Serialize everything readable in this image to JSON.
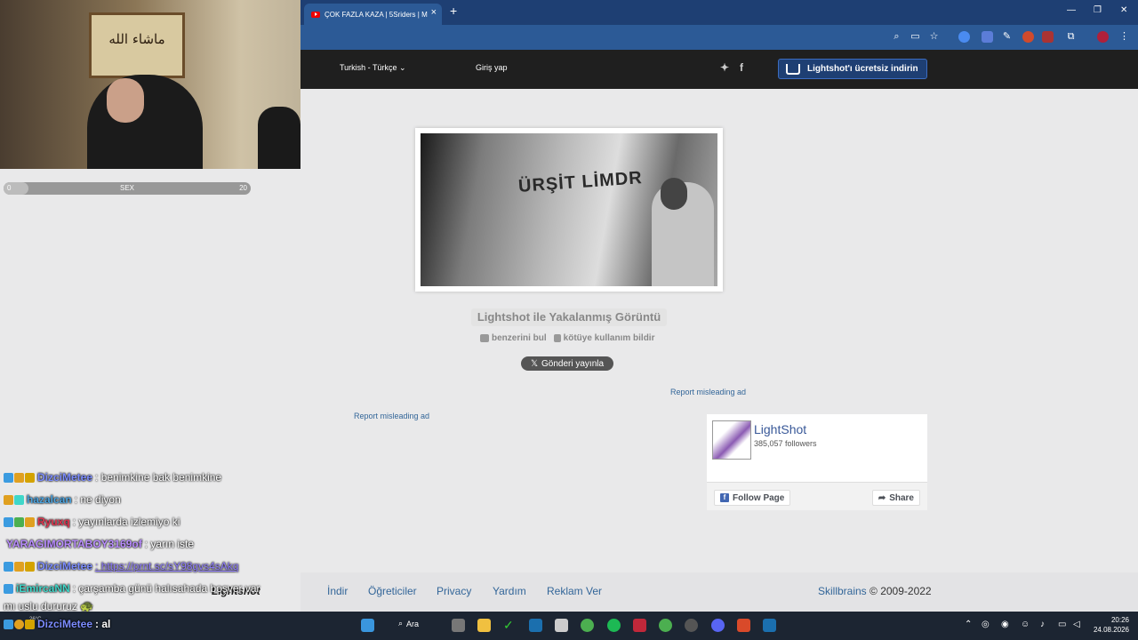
{
  "browser": {
    "tab_title": "ÇOK FAZLA KAZA | 5Sriders | M",
    "tab_close": "×",
    "new_tab": "+",
    "window_controls": [
      "—",
      "❐",
      "✕"
    ]
  },
  "site_header": {
    "language": "Turkish - Türkçe",
    "language_caret": "⌄",
    "login": "Giriş yap",
    "download_button": "Lightshot'ı ücretsiz indirin"
  },
  "stream_overlay": {
    "progress_min": "0",
    "progress_label": "SEX",
    "progress_max": "20",
    "progress_value": 0.1
  },
  "screenshot": {
    "image_text": "ÜRŞİT LİMDR",
    "caption": "Lightshot ile Yakalanmış Görüntü",
    "find_similar": "benzerini bul",
    "report_abuse": "kötüye kullanım bildir",
    "tweet_button": "Gönderi yayınla"
  },
  "ads": {
    "report_1": "Report misleading ad",
    "report_2": "Report misleading ad"
  },
  "facebook": {
    "page_name": "LightShot",
    "followers": "385,057 followers",
    "follow_button": "Follow Page",
    "share_button": "Share"
  },
  "footer": {
    "logo": "Lightshot",
    "links": [
      "İndir",
      "Öğreticiler",
      "Privacy",
      "Yardım",
      "Reklam Ver"
    ],
    "company": "Skillbrains",
    "copyright": "© 2009-2022"
  },
  "chat": [
    {
      "user": "DizciMetee",
      "message": ": benimkine bak benimkine",
      "color": "#7b8cff"
    },
    {
      "user": "hazalcan",
      "message": ": ne diyon",
      "color": "#4aa3df"
    },
    {
      "user": "Ryuxq",
      "message": ": yayınlarda izlemiyo ki",
      "color": "#e0344f"
    },
    {
      "user": "YARAGIMORTABOY3169of",
      "message": ": yarın iste",
      "color": "#b98cff"
    },
    {
      "user": "DizciMetee",
      "message": ": https://prnt.sc/sY98gvs4sAkq",
      "color": "#7b8cff"
    },
    {
      "user": "iEmircaNN",
      "message": ": çarşamba günü halısahada boşver var",
      "color": "#3fd7c9"
    }
  ],
  "chat_wrap": "mı uslu dururuz 🐢",
  "chat_last": {
    "user": "DizciMetee",
    "message": ": al"
  },
  "taskbar": {
    "search": "Ara",
    "weather": "26°C",
    "time": "20:26",
    "date": "24.08.2026"
  }
}
